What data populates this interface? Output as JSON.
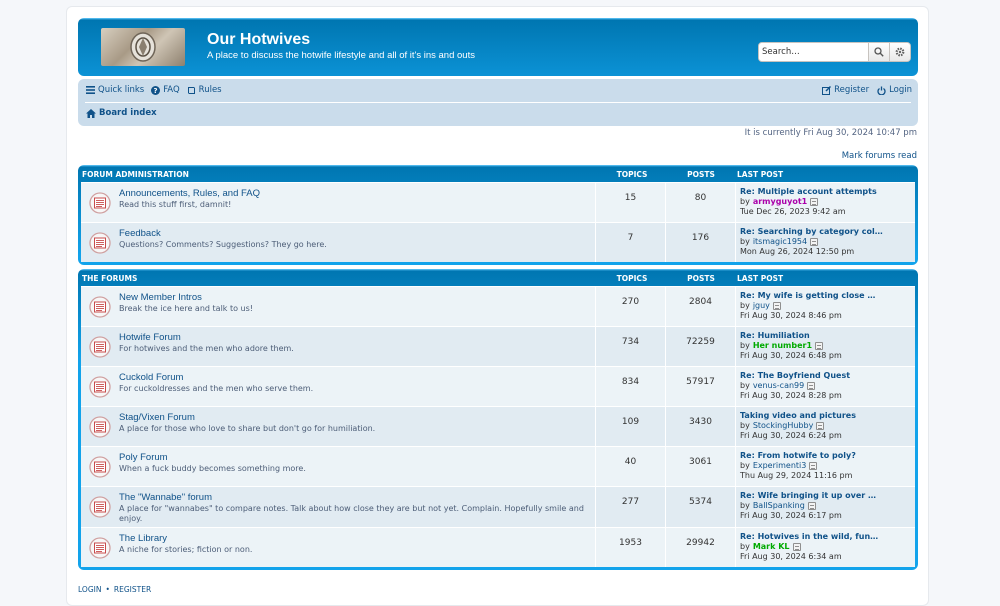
{
  "header": {
    "title": "Our Hotwives",
    "description": "A place to discuss the hotwife lifestyle and all of it's ins and outs",
    "search_placeholder": "Search…"
  },
  "nav": {
    "quick_links": "Quick links",
    "faq": "FAQ",
    "rules": "Rules",
    "register": "Register",
    "login": "Login",
    "breadcrumb": "Board index"
  },
  "status": {
    "datetime": "It is currently Fri Aug 30, 2024 10:47 pm",
    "mark_read": "Mark forums read"
  },
  "categories": [
    {
      "title": "FORUM ADMINISTRATION",
      "col_topics": "TOPICS",
      "col_posts": "POSTS",
      "col_last": "LAST POST",
      "forums": [
        {
          "name": "Announcements, Rules, and FAQ",
          "desc": "Read this stuff first, damnit!",
          "topics": "15",
          "posts": "80",
          "last_title": "Re: Multiple account attempts",
          "by": "by",
          "last_user": "armyguyot1",
          "user_color": "#AA00AA",
          "last_date": "Tue Dec 26, 2023 9:42 am"
        },
        {
          "name": "Feedback",
          "desc": "Questions? Comments? Suggestions? They go here.",
          "topics": "7",
          "posts": "176",
          "last_title": "Re: Searching by category col…",
          "by": "by",
          "last_user": "itsmagic1954",
          "user_color": "#105289",
          "last_date": "Mon Aug 26, 2024 12:50 pm"
        }
      ]
    },
    {
      "title": "THE FORUMS",
      "col_topics": "TOPICS",
      "col_posts": "POSTS",
      "col_last": "LAST POST",
      "forums": [
        {
          "name": "New Member Intros",
          "desc": "Break the ice here and talk to us!",
          "topics": "270",
          "posts": "2804",
          "last_title": "Re: My wife is getting close …",
          "by": "by",
          "last_user": "jguy",
          "user_color": "#105289",
          "last_date": "Fri Aug 30, 2024 8:46 pm"
        },
        {
          "name": "Hotwife Forum",
          "desc": "For hotwives and the men who adore them.",
          "topics": "734",
          "posts": "72259",
          "last_title": "Re: Humiliation",
          "by": "by",
          "last_user": "Her number1",
          "user_color": "#00AA00",
          "last_date": "Fri Aug 30, 2024 6:48 pm"
        },
        {
          "name": "Cuckold Forum",
          "desc": "For cuckoldresses and the men who serve them.",
          "topics": "834",
          "posts": "57917",
          "last_title": "Re: The Boyfriend Quest",
          "by": "by",
          "last_user": "venus-can99",
          "user_color": "#105289",
          "last_date": "Fri Aug 30, 2024 8:28 pm"
        },
        {
          "name": "Stag/Vixen Forum",
          "desc": "A place for those who love to share but don't go for humiliation.",
          "topics": "109",
          "posts": "3430",
          "last_title": "Taking video and pictures",
          "by": "by",
          "last_user": "StockingHubby",
          "user_color": "#105289",
          "last_date": "Fri Aug 30, 2024 6:24 pm"
        },
        {
          "name": "Poly Forum",
          "desc": "When a fuck buddy becomes something more.",
          "topics": "40",
          "posts": "3061",
          "last_title": "Re: From hotwife to poly?",
          "by": "by",
          "last_user": "Experimenti3",
          "user_color": "#105289",
          "last_date": "Thu Aug 29, 2024 11:16 pm"
        },
        {
          "name": "The \"Wannabe\" forum",
          "desc": "A place for \"wannabes\" to compare notes. Talk about how close they are but not yet. Complain. Hopefully smile and enjoy.",
          "topics": "277",
          "posts": "5374",
          "last_title": "Re: Wife bringing it up over …",
          "by": "by",
          "last_user": "BallSpanking",
          "user_color": "#105289",
          "last_date": "Fri Aug 30, 2024 6:17 pm"
        },
        {
          "name": "The Library",
          "desc": "A niche for stories; fiction or non.",
          "topics": "1953",
          "posts": "29942",
          "last_title": "Re: Hotwives in the wild, fun…",
          "by": "by",
          "last_user": "Mark KL",
          "user_color": "#00AA00",
          "last_date": "Fri Aug 30, 2024 6:34 am"
        }
      ]
    }
  ],
  "footer": {
    "login": "LOGIN",
    "sep": "•",
    "register": "REGISTER"
  }
}
